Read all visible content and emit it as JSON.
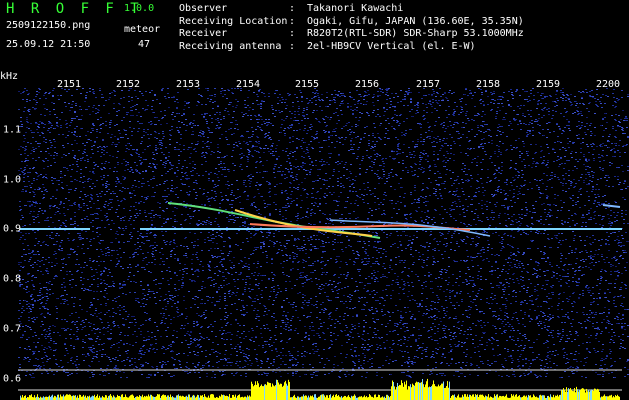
{
  "header": {
    "app_title": "H R O F F T",
    "version": "1.0.0",
    "file_name": "2509122150.png",
    "mode": "meteor",
    "timestamp": "25.09.12 21:50",
    "count": "47"
  },
  "station": [
    {
      "label": "Observer",
      "sep": ":",
      "value": "Takanori Kawachi"
    },
    {
      "label": "Receiving Location",
      "sep": ":",
      "value": "Ogaki, Gifu, JAPAN (136.60E, 35.35N)"
    },
    {
      "label": "Receiver",
      "sep": ":",
      "value": "R820T2(RTL-SDR) SDR-Sharp 53.1000MHz"
    },
    {
      "label": "Receiving antenna",
      "sep": ":",
      "value": "2el-HB9CV Vertical (el. E-W)"
    }
  ],
  "spectrogram": {
    "y_unit": "kHz",
    "x_ticks": [
      "2151",
      "2152",
      "2153",
      "2154",
      "2155",
      "2156",
      "2157",
      "2158",
      "2159",
      "2200"
    ],
    "y_ticks": [
      "1.1",
      "1.0",
      "0.9",
      "0.8",
      "0.7",
      "0.6"
    ],
    "colors": {
      "background": "#000000",
      "noise": "#1a2a8c",
      "carrier": "#7fd8ff",
      "meteor": "#ffd24a",
      "level_bars": "#ffff00",
      "guide_line": "#dddddd"
    }
  }
}
